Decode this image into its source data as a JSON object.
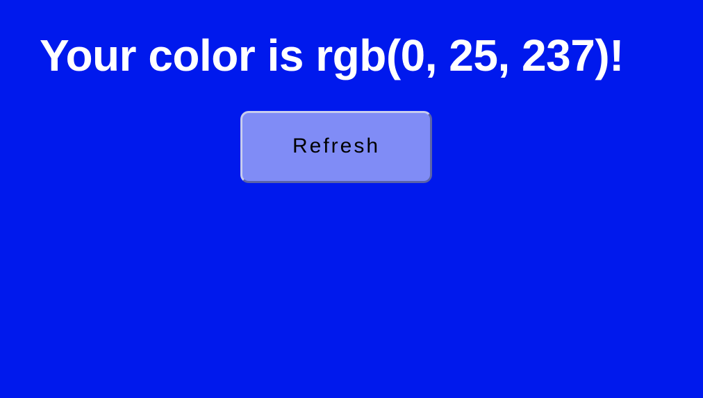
{
  "headline": "Your color is rgb(0, 25, 237)!",
  "refresh_button": {
    "label": "Refresh"
  },
  "colors": {
    "background": "#0019ed",
    "button_background": "#808cf6",
    "headline_text": "#ffffff"
  }
}
